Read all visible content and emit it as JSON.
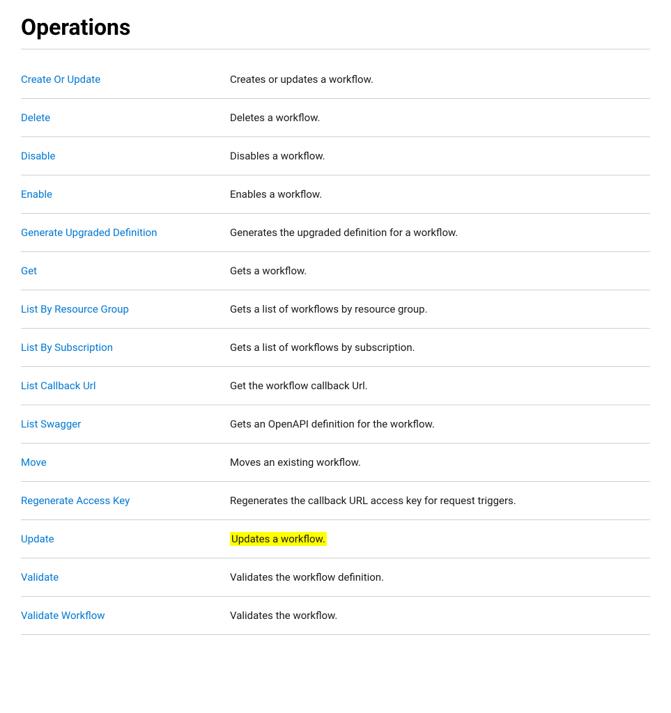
{
  "page": {
    "title": "Operations"
  },
  "operations": [
    {
      "id": "create-or-update",
      "name": "Create Or Update",
      "description": "Creates or updates a workflow.",
      "highlight": false
    },
    {
      "id": "delete",
      "name": "Delete",
      "description": "Deletes a workflow.",
      "highlight": false
    },
    {
      "id": "disable",
      "name": "Disable",
      "description": "Disables a workflow.",
      "highlight": false
    },
    {
      "id": "enable",
      "name": "Enable",
      "description": "Enables a workflow.",
      "highlight": false
    },
    {
      "id": "generate-upgraded-definition",
      "name": "Generate Upgraded Definition",
      "description": "Generates the upgraded definition for a workflow.",
      "highlight": false
    },
    {
      "id": "get",
      "name": "Get",
      "description": "Gets a workflow.",
      "highlight": false
    },
    {
      "id": "list-by-resource-group",
      "name": "List By Resource Group",
      "description": "Gets a list of workflows by resource group.",
      "highlight": false
    },
    {
      "id": "list-by-subscription",
      "name": "List By Subscription",
      "description": "Gets a list of workflows by subscription.",
      "highlight": false
    },
    {
      "id": "list-callback-url",
      "name": "List Callback Url",
      "description": "Get the workflow callback Url.",
      "highlight": false
    },
    {
      "id": "list-swagger",
      "name": "List Swagger",
      "description": "Gets an OpenAPI definition for the workflow.",
      "highlight": false
    },
    {
      "id": "move",
      "name": "Move",
      "description": "Moves an existing workflow.",
      "highlight": false
    },
    {
      "id": "regenerate-access-key",
      "name": "Regenerate Access Key",
      "description": "Regenerates the callback URL access key for request triggers.",
      "highlight": false
    },
    {
      "id": "update",
      "name": "Update",
      "description": "Updates a workflow.",
      "highlight": true
    },
    {
      "id": "validate",
      "name": "Validate",
      "description": "Validates the workflow definition.",
      "highlight": false
    },
    {
      "id": "validate-workflow",
      "name": "Validate Workflow",
      "description": "Validates the workflow.",
      "highlight": false
    }
  ]
}
